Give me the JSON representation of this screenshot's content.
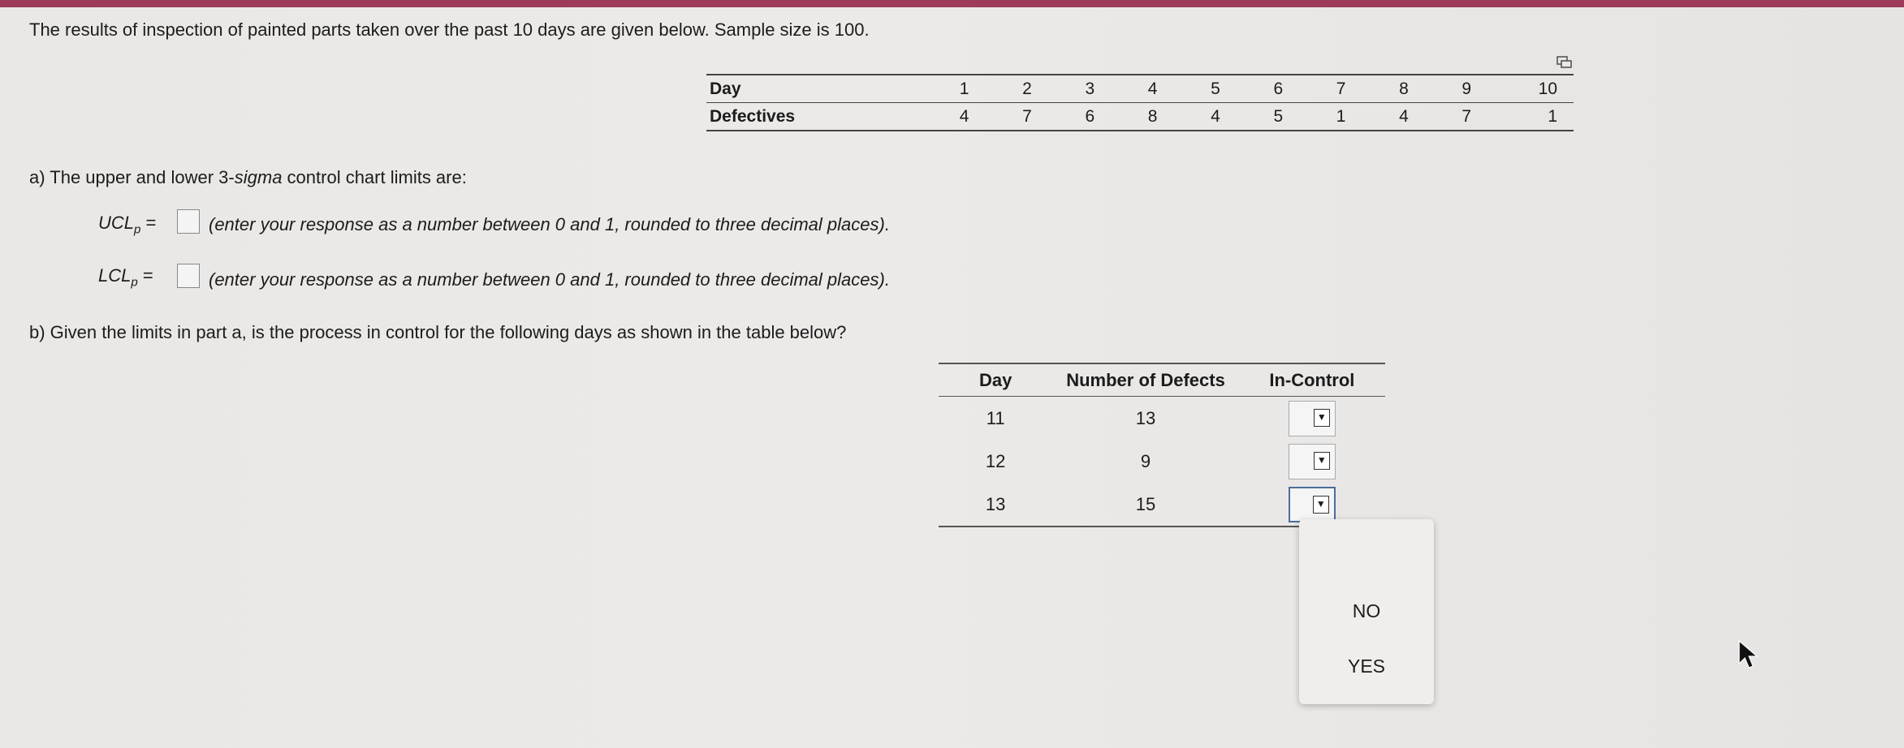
{
  "intro": "The results of inspection of painted parts taken over the past 10 days are given below. Sample size is 100.",
  "table1": {
    "row_labels": [
      "Day",
      "Defectives"
    ],
    "days": [
      "1",
      "2",
      "3",
      "4",
      "5",
      "6",
      "7",
      "8",
      "9",
      "10"
    ],
    "defectives": [
      "4",
      "7",
      "6",
      "8",
      "4",
      "5",
      "1",
      "4",
      "7",
      "1"
    ]
  },
  "part_a": {
    "prompt_pre": "a) The upper and lower 3-",
    "prompt_italic": "sigma",
    "prompt_post": " control chart limits are:",
    "ucl_label": "UCL",
    "lcl_label": "LCL",
    "subscript": "p",
    "equals": "=",
    "instruction": "(enter your response as a number between 0 and 1, rounded to three decimal places)."
  },
  "part_b": {
    "prompt": "b) Given the limits in part a, is the process in control for the following days as shown in the table below?"
  },
  "control_table": {
    "headers": [
      "Day",
      "Number of Defects",
      "In-Control"
    ],
    "rows": [
      {
        "day": "11",
        "defects": "13"
      },
      {
        "day": "12",
        "defects": "9"
      },
      {
        "day": "13",
        "defects": "15"
      }
    ]
  },
  "dropdown_options": [
    "NO",
    "YES"
  ],
  "icons": {
    "dropdown_arrow": "triangle-down",
    "copy": "copy-icon",
    "cursor": "mouse-pointer"
  },
  "colors": {
    "top_bar": "#9c3b5a",
    "active_border": "#4b6e9c"
  }
}
